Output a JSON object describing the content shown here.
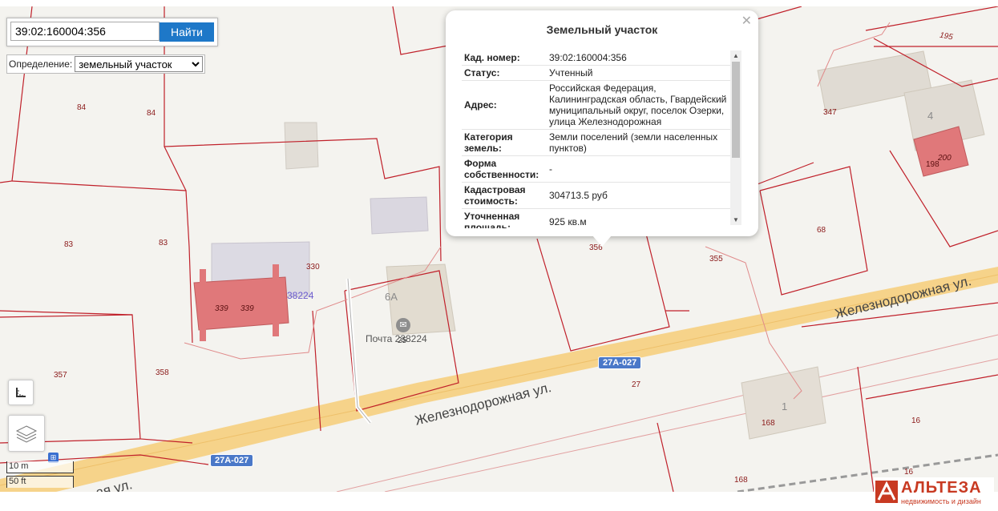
{
  "search": {
    "value": "39:02:160004:356",
    "button_label": "Найти"
  },
  "definition": {
    "label": "Определение:",
    "selected": "земельный участок"
  },
  "popup": {
    "title": "Земельный участок",
    "rows": [
      {
        "key": "Кад. номер:",
        "value": "39:02:160004:356"
      },
      {
        "key": "Статус:",
        "value": "Учтенный"
      },
      {
        "key": "Адрес:",
        "value": "Российская Федерация, Калининградская область, Гвардейский муниципальный округ, поселок Озерки, улица Железнодорожная"
      },
      {
        "key": "Категория земель:",
        "value": "Земли поселений (земли населенных пунктов)"
      },
      {
        "key": "Форма собственности:",
        "value": "-"
      },
      {
        "key": "Кадастровая стоимость:",
        "value": "304713.5 руб"
      },
      {
        "key": "Уточненная площадь:",
        "value": "925 кв.м"
      }
    ]
  },
  "map": {
    "parcel_labels": [
      "84",
      "84",
      "83",
      "83",
      "330",
      "339",
      "339",
      "357",
      "358",
      "356",
      "355",
      "347",
      "4",
      "200",
      "198",
      "68",
      "27",
      "168",
      "1",
      "16",
      "168",
      "16",
      "195",
      "25"
    ],
    "building_labels": [
      "6A"
    ],
    "poi": "Почта 238224",
    "blue_label": "38224",
    "streets": [
      "Железнодорожная ул.",
      "Железнодорожная ул.",
      "ая ул."
    ],
    "road_shields": [
      "27A-027",
      "27A-027"
    ]
  },
  "scale": {
    "metric": "10 m",
    "imperial": "50 ft"
  },
  "logo": {
    "name": "АЛЬТЕЗА",
    "tagline": "недвижимость и дизайн"
  }
}
